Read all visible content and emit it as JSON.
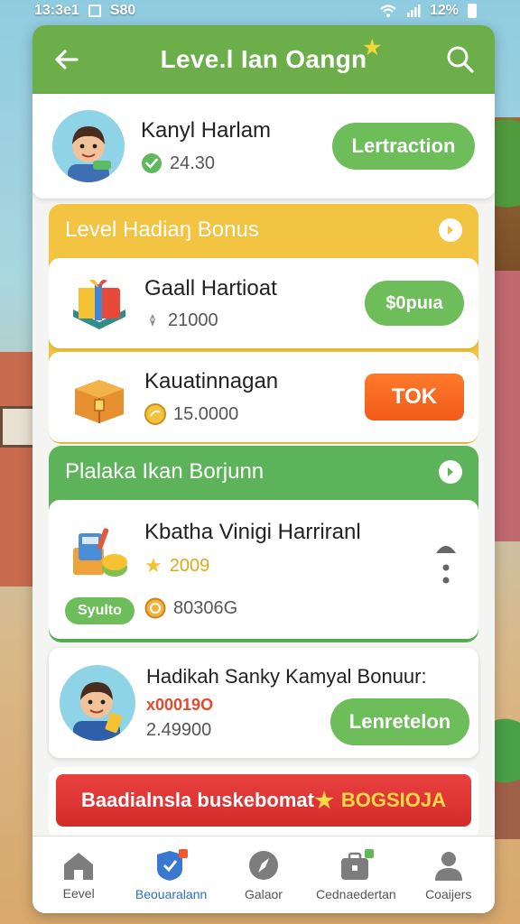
{
  "status_bar": {
    "time": "13:3e1",
    "carrier": "S80",
    "battery": "12%"
  },
  "header": {
    "title": "Leve.l Ian Oangn"
  },
  "profile": {
    "name": "Kanyl Harlam",
    "points": "24.30",
    "action_label": "Lertraction"
  },
  "section_bonus": {
    "title": "Level Hadiaŋ Bonus",
    "items": [
      {
        "title": "Gaall Hartioat",
        "value": "21000",
        "action_label": "$0puıa",
        "icon": "gift-box-icon"
      },
      {
        "title": "Kauatinnagan",
        "value": "15.0000",
        "action_label": "TOK",
        "icon": "treasure-chest-icon"
      }
    ]
  },
  "section_rewards": {
    "title": "Plalaka Ikan Borjunn",
    "item": {
      "title": "Kbatha Vinigi Harriranl",
      "stars": "2009",
      "coins": "80306G",
      "tag": "Syulto"
    }
  },
  "profile2": {
    "title": "Hadikah Sanky Kamyal Bonuur:",
    "highlight": "x00019O",
    "value": "2.49900",
    "action_label": "Lenretelon"
  },
  "promo": {
    "text": "Baadialnsla buskebomat",
    "value": "BOGSIOJA"
  },
  "nav": [
    {
      "label": "Eevel",
      "icon": "home-icon",
      "active": false
    },
    {
      "label": "Beouaralann",
      "icon": "shield-badge-icon",
      "active": true
    },
    {
      "label": "Galaor",
      "icon": "compass-icon",
      "active": false
    },
    {
      "label": "Cednaedertan",
      "icon": "briefcase-icon",
      "active": false
    },
    {
      "label": "Coaijers",
      "icon": "person-icon",
      "active": false
    }
  ],
  "colors": {
    "header_green": "#6bae4a",
    "section_yellow": "#f3c342",
    "section_green": "#5db35a",
    "button_green": "#6dbd5a",
    "button_orange": "#f05a1a",
    "promo_red": "#d42b2b",
    "active_blue": "#2d6fc2"
  }
}
